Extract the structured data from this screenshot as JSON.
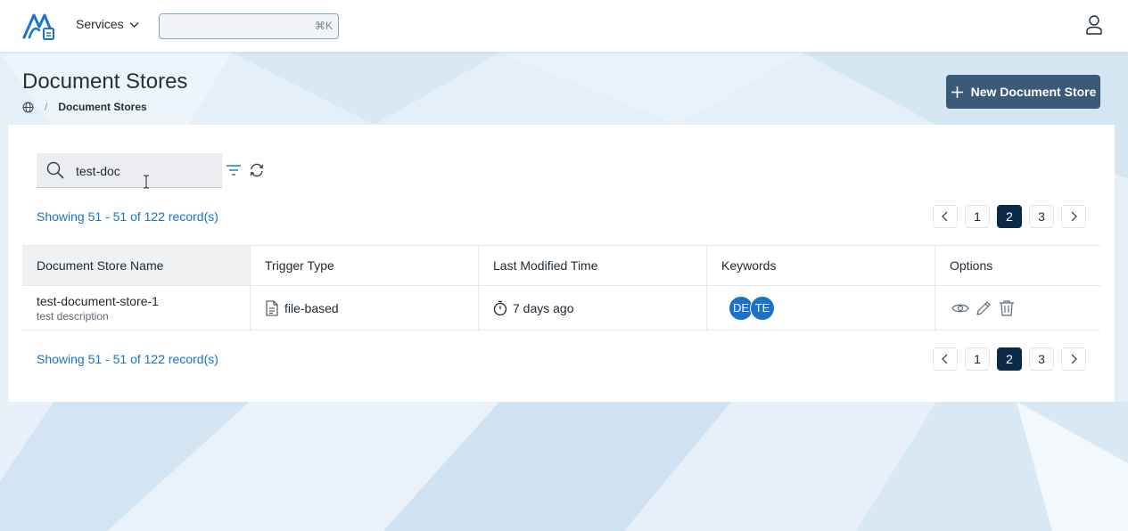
{
  "header": {
    "services_label": "Services",
    "search_placeholder": "",
    "search_shortcut": "⌘K"
  },
  "page": {
    "title": "Document Stores",
    "breadcrumb_current": "Document Stores",
    "breadcrumb_sep": "/",
    "new_button_label": "New Document Store"
  },
  "filter": {
    "search_value": "test-doc"
  },
  "pagination": {
    "showing_text": "Showing 51 - 51 of 122 record(s)",
    "pages": [
      "1",
      "2",
      "3"
    ],
    "active_page": "2"
  },
  "table": {
    "columns": [
      "Document Store Name",
      "Trigger Type",
      "Last Modified Time",
      "Keywords",
      "Options"
    ],
    "rows": [
      {
        "name": "test-document-store-1",
        "description": "test description",
        "trigger_type": "file-based",
        "last_modified": "7 days ago",
        "keywords": [
          "DE",
          "TE"
        ]
      }
    ]
  },
  "colors": {
    "accent": "#1a73c9",
    "primary_button": "#3a5a7a",
    "active_page": "#0b2a4a"
  }
}
